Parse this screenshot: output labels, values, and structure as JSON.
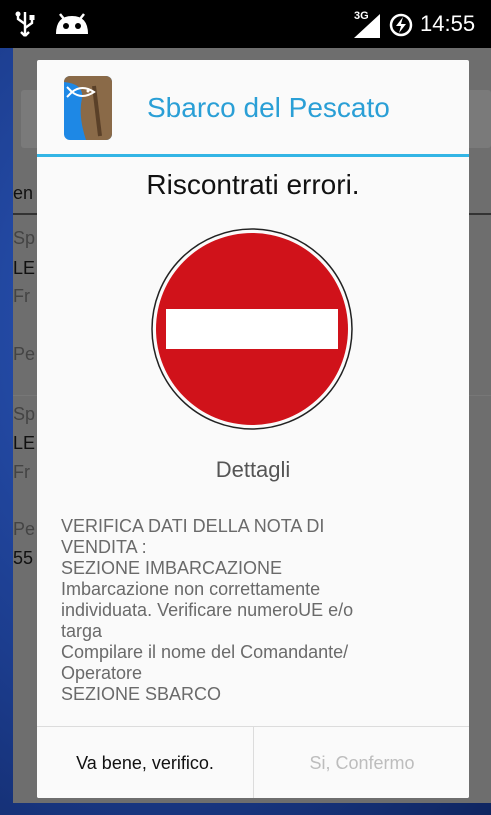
{
  "status_bar": {
    "network_type": "3G",
    "time": "14:55",
    "icons": [
      "usb-icon",
      "android-debug-icon",
      "signal-icon",
      "battery-charging-icon"
    ]
  },
  "background_app": {
    "rows": [
      {
        "label": "en"
      },
      {
        "label": "Sp"
      },
      {
        "label": "LE"
      },
      {
        "label": "Fr"
      },
      {
        "label": "Pe"
      },
      {
        "label": "Sp"
      },
      {
        "label": "LE"
      },
      {
        "label": "Fr"
      },
      {
        "label": "Pe"
      },
      {
        "label": "55"
      }
    ]
  },
  "dialog": {
    "app_title": "Sbarco del Pescato",
    "heading": "Riscontrati errori.",
    "icon": "no-entry-icon",
    "details_label": "Dettagli",
    "message_lines": [
      "VERIFICA DATI DELLA NOTA DI",
      "VENDITA :",
      "SEZIONE IMBARCAZIONE",
      "Imbarcazione non correttamente",
      "individuata. Verificare numeroUE e/o",
      "targa",
      "Compilare il nome del Comandante/",
      "Operatore",
      "SEZIONE SBARCO"
    ],
    "buttons": {
      "ok_label": "Va bene, verifico.",
      "confirm_label": "Si, Confermo"
    }
  },
  "colors": {
    "accent": "#33b5e5",
    "title": "#2a9fd6",
    "sign_red": "#d0121a",
    "disabled_text": "#bdbdbd"
  }
}
